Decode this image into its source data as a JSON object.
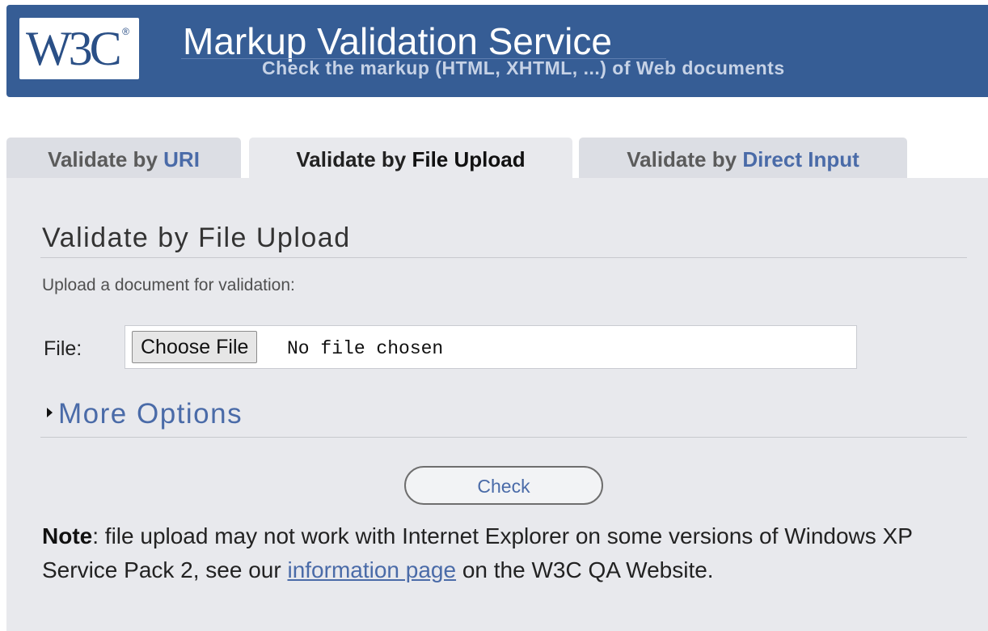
{
  "header": {
    "logo_text": "W3C",
    "logo_reg": "®",
    "title": "Markup Validation Service",
    "subtitle": "Check the markup (HTML, XHTML, ...) of Web documents"
  },
  "tabs": [
    {
      "prefix": "Validate by ",
      "highlight": "URI",
      "active": false
    },
    {
      "prefix": "Validate by ",
      "highlight": "File Upload",
      "active": true
    },
    {
      "prefix": "Validate by ",
      "highlight": "Direct Input",
      "active": false
    }
  ],
  "form": {
    "section_title": "Validate by File Upload",
    "description": "Upload a document for validation:",
    "file_label": "File:",
    "choose_file_label": "Choose File",
    "no_file_text": "No file chosen",
    "more_options_label": "More Options",
    "check_label": "Check"
  },
  "note": {
    "bold": "Note",
    "text_before": ": file upload may not work with Internet Explorer on some versions of Windows XP Service Pack 2, see our ",
    "link_text": "information page",
    "text_after": " on the W3C QA Website."
  },
  "colors": {
    "banner": "#365d95",
    "link": "#4a6ba8",
    "panel": "#e8e9ed",
    "tab_inactive": "#dcdee4"
  }
}
